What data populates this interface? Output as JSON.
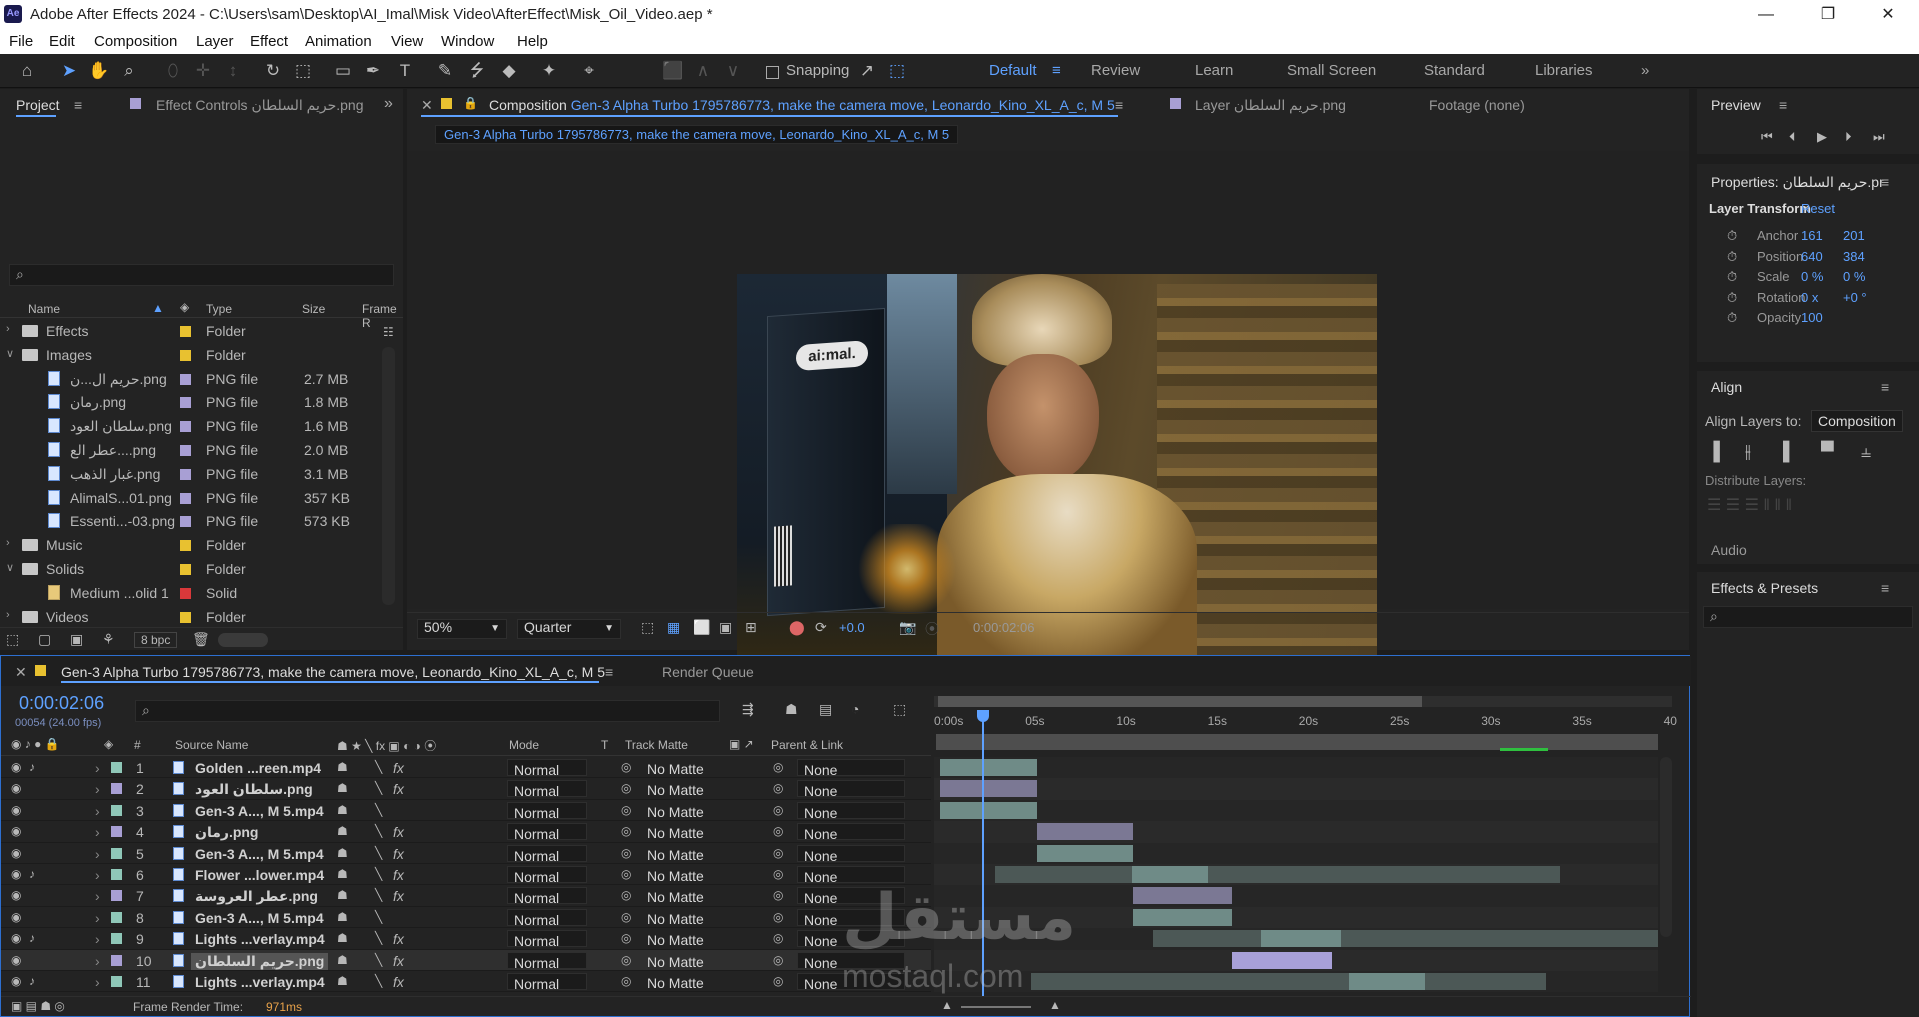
{
  "app": {
    "title": "Adobe After Effects 2024 - C:\\Users\\sam\\Desktop\\AI_Imal\\Misk Video\\AfterEffect\\Misk_Oil_Video.aep *",
    "icon_label": "Ae"
  },
  "menu": [
    "File",
    "Edit",
    "Composition",
    "Layer",
    "Effect",
    "Animation",
    "View",
    "Window",
    "Help"
  ],
  "toolbar": {
    "snapping": "Snapping",
    "workspaces": [
      "Default",
      "Review",
      "Learn",
      "Small Screen",
      "Standard",
      "Libraries"
    ]
  },
  "project": {
    "tab_project": "Project",
    "tab_effect_controls": "Effect Controls حريم السلطان.png",
    "columns": {
      "name": "Name",
      "type": "Type",
      "size": "Size",
      "frame": "Frame R"
    },
    "items": [
      {
        "name": "Effects",
        "type": "Folder",
        "size": "",
        "kind": "folder",
        "color": "#e8c130",
        "indent": 0
      },
      {
        "name": "Images",
        "type": "Folder",
        "size": "",
        "kind": "folder-open",
        "color": "#e8c130",
        "indent": 0
      },
      {
        "name": "حريم ال...ن.png",
        "type": "PNG file",
        "size": "2.7 MB",
        "kind": "file",
        "color": "#a89fd4",
        "indent": 1
      },
      {
        "name": "رمان.png",
        "type": "PNG file",
        "size": "1.8 MB",
        "kind": "file",
        "color": "#a89fd4",
        "indent": 1
      },
      {
        "name": "سلطان العود.png",
        "type": "PNG file",
        "size": "1.6 MB",
        "kind": "file",
        "color": "#a89fd4",
        "indent": 1
      },
      {
        "name": "عطر الع....png",
        "type": "PNG file",
        "size": "2.0 MB",
        "kind": "file",
        "color": "#a89fd4",
        "indent": 1
      },
      {
        "name": "غبار الذهب.png",
        "type": "PNG file",
        "size": "3.1 MB",
        "kind": "file",
        "color": "#a89fd4",
        "indent": 1
      },
      {
        "name": "AlimalS...01.png",
        "type": "PNG file",
        "size": "357 KB",
        "kind": "file",
        "color": "#a89fd4",
        "indent": 1
      },
      {
        "name": "Essenti...-03.png",
        "type": "PNG file",
        "size": "573 KB",
        "kind": "file",
        "color": "#a89fd4",
        "indent": 1
      },
      {
        "name": "Music",
        "type": "Folder",
        "size": "",
        "kind": "folder",
        "color": "#e8c130",
        "indent": 0
      },
      {
        "name": "Solids",
        "type": "Folder",
        "size": "",
        "kind": "folder-open",
        "color": "#e8c130",
        "indent": 0
      },
      {
        "name": "Medium ...olid 1",
        "type": "Solid",
        "size": "",
        "kind": "solid",
        "color": "#d9383a",
        "indent": 1
      },
      {
        "name": "Videos",
        "type": "Folder",
        "size": "",
        "kind": "folder",
        "color": "#e8c130",
        "indent": 0
      }
    ],
    "bpc": "8 bpc"
  },
  "composition": {
    "tab_label": "Composition",
    "comp_name": "Gen-3 Alpha Turbo 1795786773, make the camera move, Leonardo_Kino_XL_A_c, M 5",
    "layer_tab": "Layer حريم السلطان.png",
    "footage_tab": "Footage (none)",
    "zoom": "50%",
    "resolution": "Quarter",
    "exposure": "+0.0",
    "timecode": "0:00:02:06",
    "logo_text": "ai:mal."
  },
  "preview": {
    "title": "Preview"
  },
  "properties": {
    "title": "Properties: حريم السلطان.pr",
    "section": "Layer Transform",
    "reset": "Reset",
    "rows": [
      {
        "label": "Anchor",
        "v1": "161",
        "v2": "201"
      },
      {
        "label": "Position",
        "v1": "640",
        "v2": "384"
      },
      {
        "label": "Scale",
        "v1": "0 %",
        "v2": "0 %"
      },
      {
        "label": "Rotation",
        "v1": "0 x",
        "v2": "+0 °"
      },
      {
        "label": "Opacity",
        "v1": "100",
        "v2": ""
      }
    ]
  },
  "align": {
    "title": "Align",
    "align_to_label": "Align Layers to:",
    "align_to_value": "Composition",
    "distribute": "Distribute Layers:"
  },
  "audio": {
    "title": "Audio"
  },
  "effects_presets": {
    "title": "Effects & Presets"
  },
  "timeline": {
    "comp_tab": "Gen-3 Alpha Turbo 1795786773, make the camera move, Leonardo_Kino_XL_A_c, M 5",
    "render_queue": "Render Queue",
    "timecode": "0:00:02:06",
    "frame_info": "00054 (24.00 fps)",
    "columns": {
      "num": "#",
      "source": "Source Name",
      "mode": "Mode",
      "t": "T",
      "track": "Track Matte",
      "parent": "Parent & Link"
    },
    "ruler": [
      "0:00s",
      "05s",
      "10s",
      "15s",
      "20s",
      "25s",
      "30s",
      "35s",
      "40"
    ],
    "layers": [
      {
        "num": "1",
        "name": "Golden ...reen.mp4",
        "mode": "Normal",
        "track": "No Matte",
        "parent": "None",
        "color": "#8fc7b8",
        "audio": true,
        "fx": true,
        "bars": [
          [
            0,
            5.3,
            "#6f8b87"
          ]
        ]
      },
      {
        "num": "2",
        "name": "سلطان العود.png",
        "mode": "Normal",
        "track": "No Matte",
        "parent": "None",
        "color": "#a89fd4",
        "audio": false,
        "fx": true,
        "bars": [
          [
            0,
            5.3,
            "#7b7894"
          ]
        ]
      },
      {
        "num": "3",
        "name": "Gen-3 A..., M 5.mp4",
        "mode": "Normal",
        "track": "No Matte",
        "parent": "None",
        "color": "#8fc7b8",
        "audio": false,
        "fx": false,
        "bars": [
          [
            0,
            5.3,
            "#6f8b87"
          ]
        ]
      },
      {
        "num": "4",
        "name": "رمان.png",
        "mode": "Normal",
        "track": "No Matte",
        "parent": "None",
        "color": "#a89fd4",
        "audio": false,
        "fx": true,
        "bars": [
          [
            5.3,
            10.6,
            "#7b7894"
          ]
        ]
      },
      {
        "num": "5",
        "name": "Gen-3 A..., M 5.mp4",
        "mode": "Normal",
        "track": "No Matte",
        "parent": "None",
        "color": "#8fc7b8",
        "audio": false,
        "fx": true,
        "bars": [
          [
            5.3,
            10.6,
            "#6f8b87"
          ]
        ]
      },
      {
        "num": "6",
        "name": "Flower ...lower.mp4",
        "mode": "Normal",
        "track": "No Matte",
        "parent": "None",
        "color": "#8fc7b8",
        "audio": true,
        "fx": true,
        "bars": [
          [
            3,
            34,
            "#4c5856"
          ],
          [
            10.5,
            14.7,
            "#6f8b87"
          ]
        ]
      },
      {
        "num": "7",
        "name": "عطر العروسة.png",
        "mode": "Normal",
        "track": "No Matte",
        "parent": "None",
        "color": "#a89fd4",
        "audio": false,
        "fx": true,
        "bars": [
          [
            10.6,
            16,
            "#7b7894"
          ]
        ]
      },
      {
        "num": "8",
        "name": "Gen-3 A..., M 5.mp4",
        "mode": "Normal",
        "track": "No Matte",
        "parent": "None",
        "color": "#8fc7b8",
        "audio": false,
        "fx": false,
        "bars": [
          [
            10.6,
            16,
            "#6f8b87"
          ]
        ]
      },
      {
        "num": "9",
        "name": "Lights ...verlay.mp4",
        "mode": "Normal",
        "track": "No Matte",
        "parent": "None",
        "color": "#8fc7b8",
        "audio": true,
        "fx": true,
        "bars": [
          [
            11.7,
            40,
            "#4c5856"
          ],
          [
            17.6,
            22,
            "#6f8b87"
          ]
        ]
      },
      {
        "num": "10",
        "name": "حريم السلطان.png",
        "mode": "Normal",
        "track": "No Matte",
        "parent": "None",
        "color": "#a89fd4",
        "audio": false,
        "fx": true,
        "selected": true,
        "bars": [
          [
            16,
            21.5,
            "#a8a0d8"
          ]
        ]
      },
      {
        "num": "11",
        "name": "Lights ...verlay.mp4",
        "mode": "Normal",
        "track": "No Matte",
        "parent": "None",
        "color": "#8fc7b8",
        "audio": true,
        "fx": true,
        "bars": [
          [
            5,
            33.2,
            "#4c5856"
          ],
          [
            22.4,
            26.6,
            "#6f8b87"
          ]
        ]
      }
    ],
    "frame_render_label": "Frame Render Time:",
    "frame_render_value": "971ms"
  },
  "watermark": {
    "arabic": "مستقل",
    "latin": "mostaql.com"
  }
}
